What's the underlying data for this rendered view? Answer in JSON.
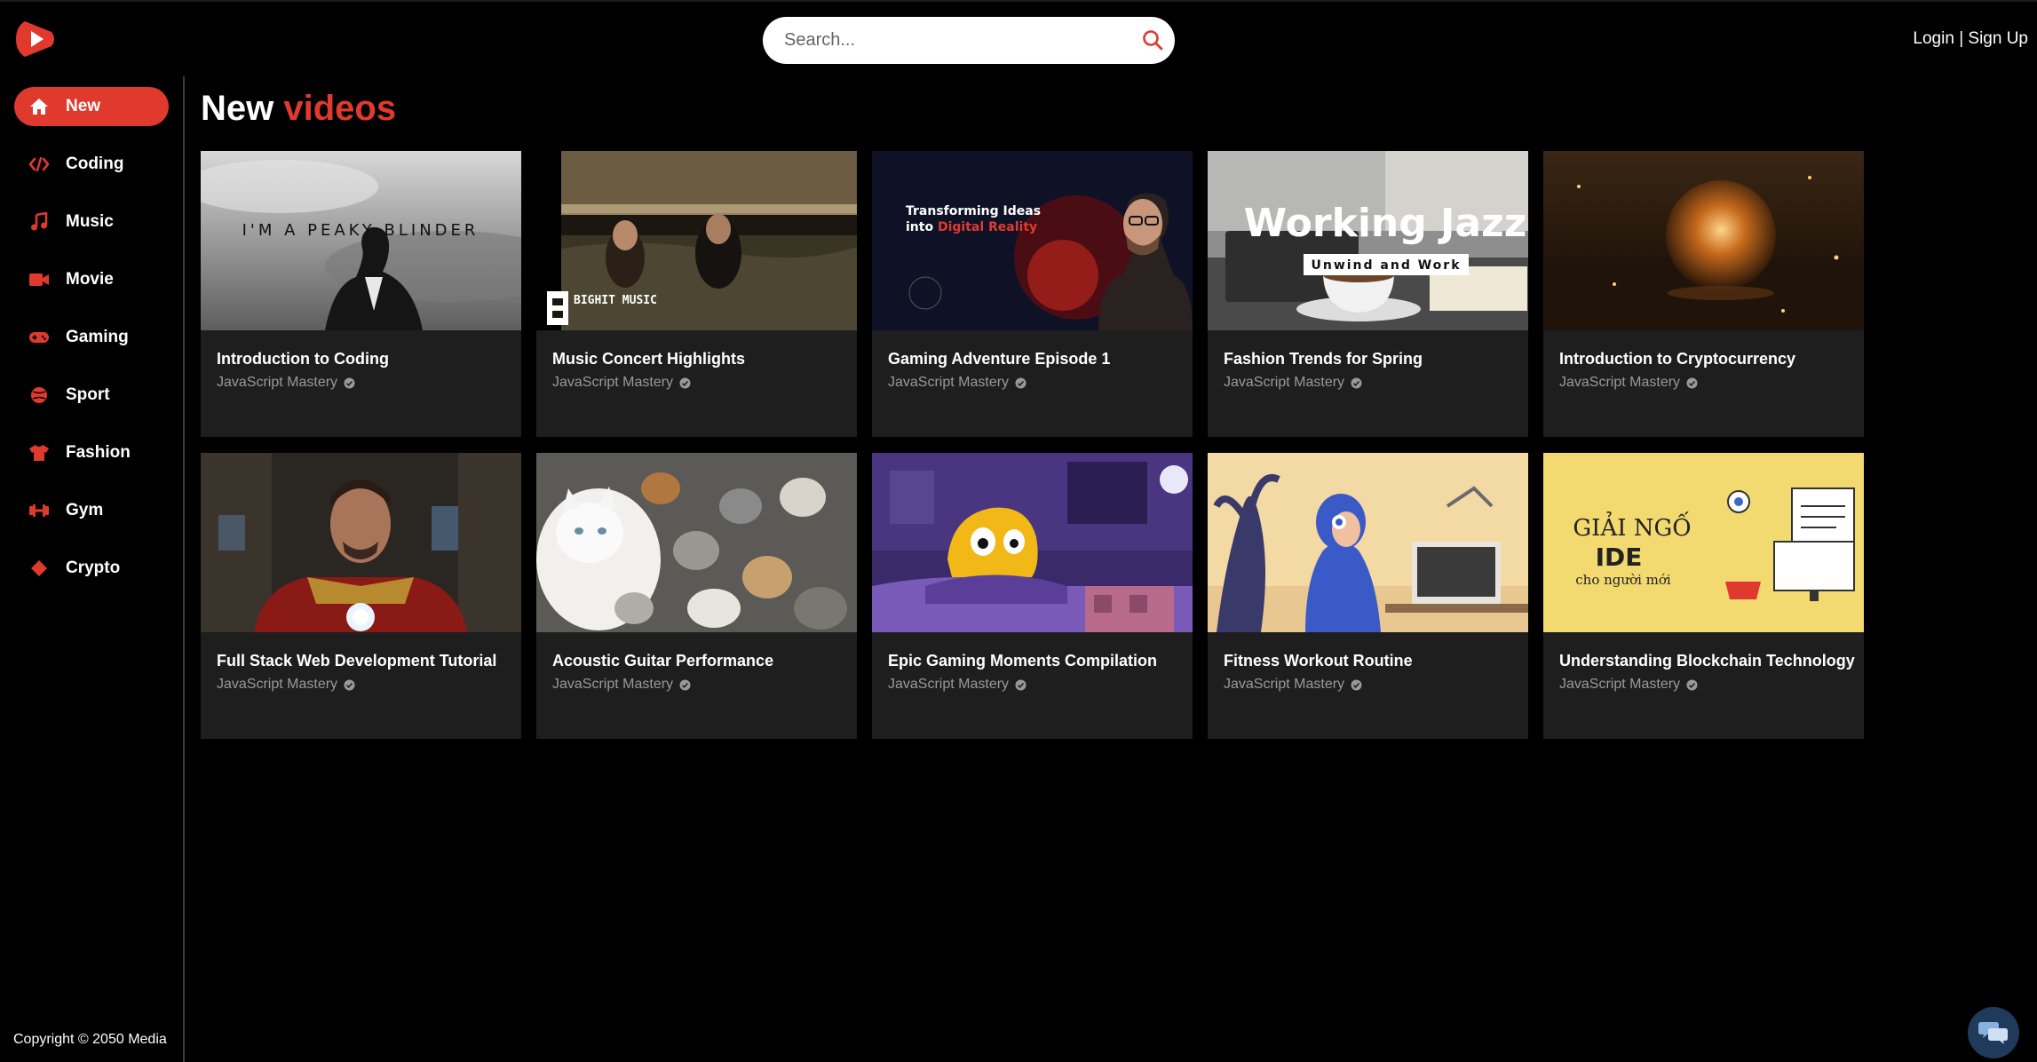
{
  "header": {
    "search_placeholder": "Search...",
    "auth_label": "Login | Sign Up"
  },
  "sidebar": {
    "items": [
      {
        "label": "New",
        "icon": "home-icon",
        "active": true
      },
      {
        "label": "Coding",
        "icon": "code-icon"
      },
      {
        "label": "Music",
        "icon": "music-note-icon"
      },
      {
        "label": "Movie",
        "icon": "video-camera-icon"
      },
      {
        "label": "Gaming",
        "icon": "gamepad-icon"
      },
      {
        "label": "Sport",
        "icon": "ball-icon"
      },
      {
        "label": "Fashion",
        "icon": "shirt-icon"
      },
      {
        "label": "Gym",
        "icon": "dumbbell-icon"
      },
      {
        "label": "Crypto",
        "icon": "diamond-icon"
      }
    ],
    "copyright": "Copyright © 2050 Media"
  },
  "main": {
    "heading_plain": "New",
    "heading_accent": "videos",
    "videos": [
      {
        "title": "Introduction to Coding",
        "channel": "JavaScript Mastery",
        "thumb_text": "I'M A PEAKY BLINDER"
      },
      {
        "title": "Music Concert Highlights",
        "channel": "JavaScript Mastery",
        "thumb_text": "BIGHIT MUSIC"
      },
      {
        "title": "Gaming Adventure Episode 1",
        "channel": "JavaScript Mastery",
        "thumb_text_1": "Transforming Ideas",
        "thumb_text_2a": "into ",
        "thumb_text_2b": "Digital Reality"
      },
      {
        "title": "Fashion Trends for Spring",
        "channel": "JavaScript Mastery",
        "thumb_text": "Working Jazz",
        "thumb_sub": "Unwind and Work"
      },
      {
        "title": "Introduction to Cryptocurrency",
        "channel": "JavaScript Mastery"
      },
      {
        "title": "Full Stack Web Development Tutorial",
        "channel": "JavaScript Mastery"
      },
      {
        "title": "Acoustic Guitar Performance",
        "channel": "JavaScript Mastery"
      },
      {
        "title": "Epic Gaming Moments Compilation",
        "channel": "JavaScript Mastery"
      },
      {
        "title": "Fitness Workout Routine",
        "channel": "JavaScript Mastery"
      },
      {
        "title": "Understanding Blockchain Technology",
        "channel": "JavaScript Mastery",
        "thumb_text_1": "GIẢI NGỐ",
        "thumb_text_2": "IDE",
        "thumb_text_3": "cho người mới"
      }
    ]
  },
  "colors": {
    "accent": "#e03a2f",
    "background": "#000000",
    "card": "#1e1e1e"
  }
}
